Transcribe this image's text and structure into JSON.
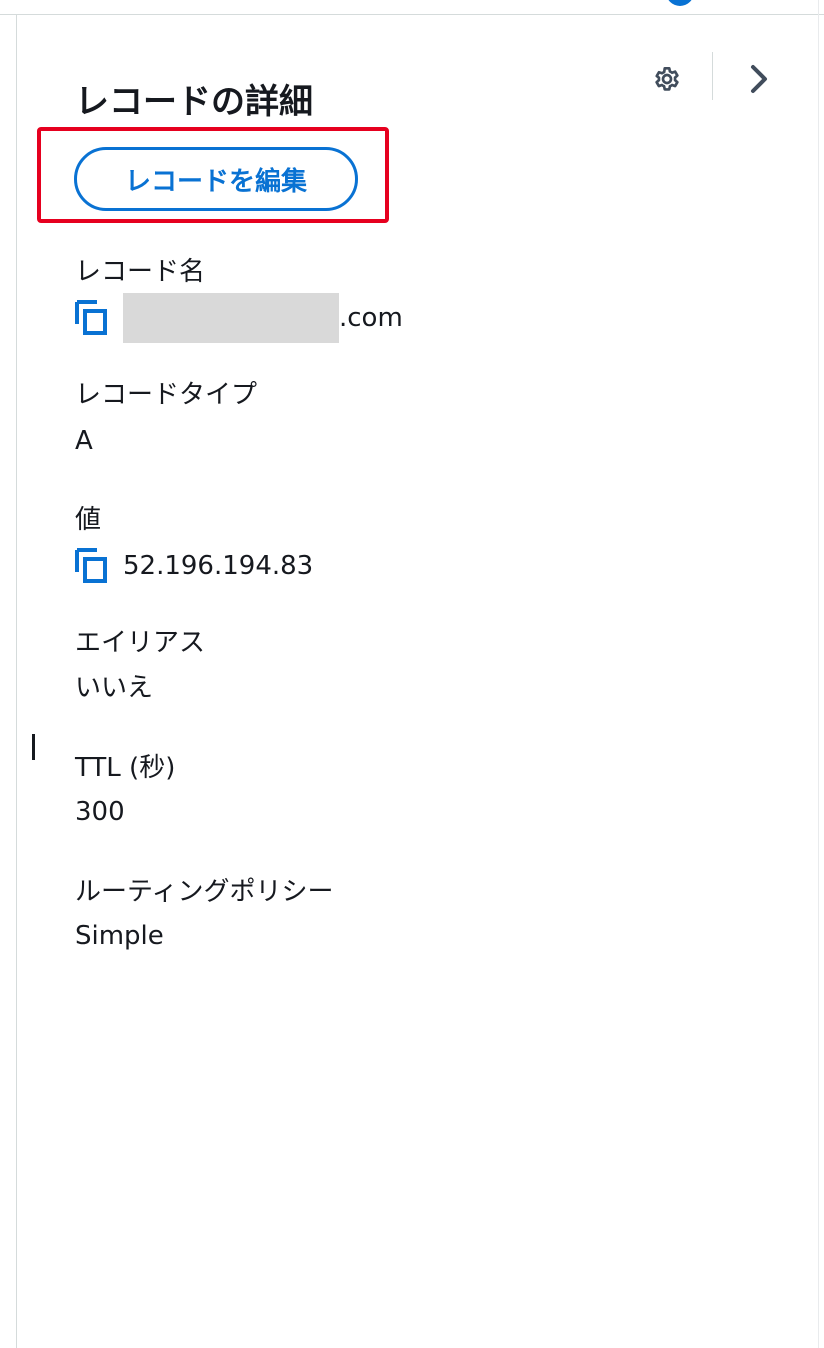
{
  "panel": {
    "title": "レコードの詳細",
    "settings_icon": "gear-icon",
    "collapse_icon": "chevron-right-icon",
    "accent_color": "#0972d3",
    "highlight_color": "#e6001f"
  },
  "edit_button": {
    "label": "レコードを編集"
  },
  "fields": {
    "record_name": {
      "label": "レコード名",
      "value_suffix": ".com",
      "copy_icon": "copy-icon"
    },
    "record_type": {
      "label": "レコードタイプ",
      "value": "A"
    },
    "value": {
      "label": "値",
      "value": "52.196.194.83",
      "copy_icon": "copy-icon"
    },
    "alias": {
      "label": "エイリアス",
      "value": "いいえ"
    },
    "ttl": {
      "label": "TTL (秒)",
      "value": "300"
    },
    "routing_policy": {
      "label": "ルーティングポリシー",
      "value": "Simple"
    }
  }
}
